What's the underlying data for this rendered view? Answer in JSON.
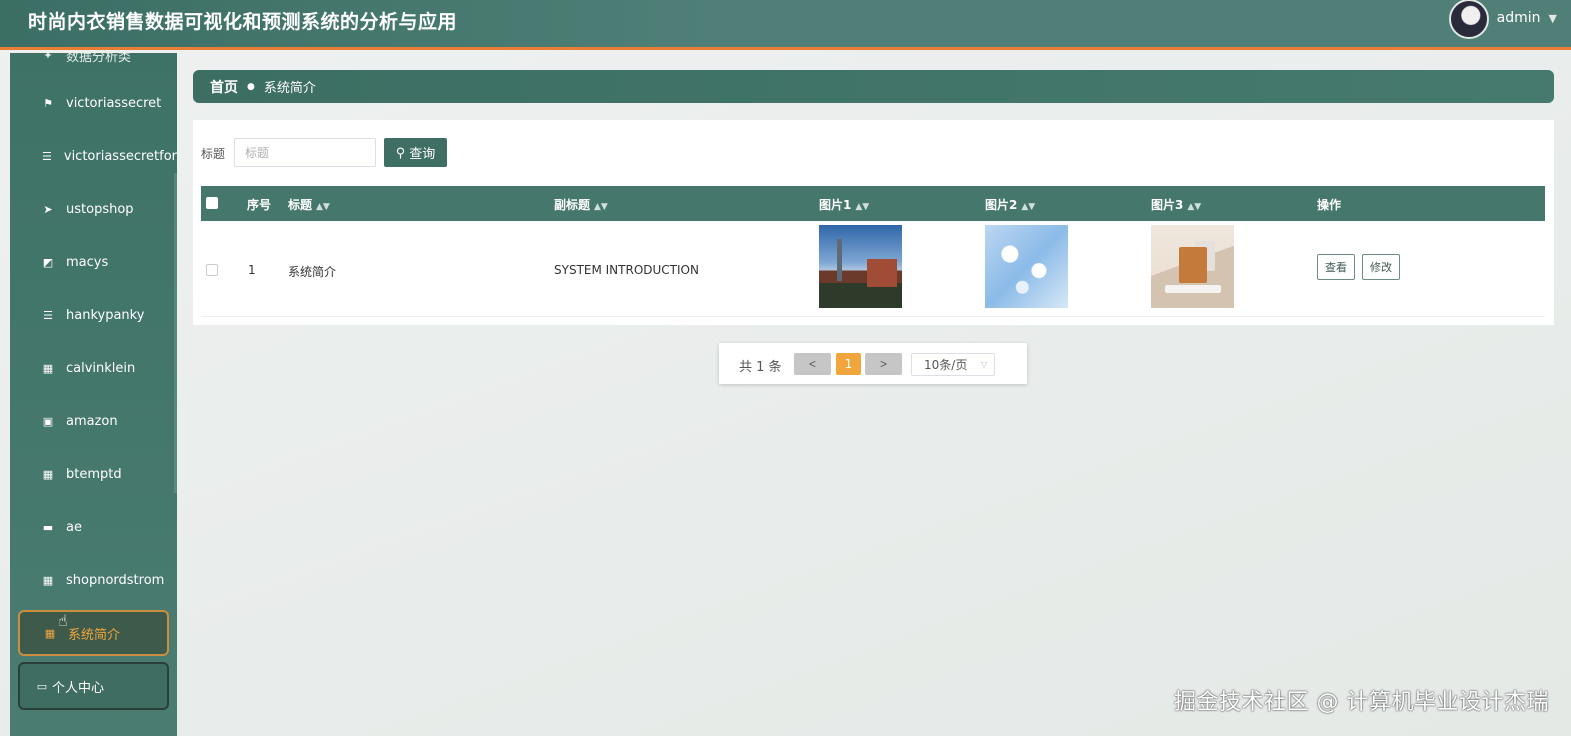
{
  "header": {
    "title": "时尚内衣销售数据可视化和预测系统的分析与应用",
    "username": "admin",
    "avatar_icon": "avatar-icon"
  },
  "sidebar": {
    "partial_item": "数据分析类",
    "items": [
      {
        "label": "victoriassecret",
        "icon": "flag-icon",
        "glyph": "⚑"
      },
      {
        "label": "victoriassecretforecast",
        "icon": "list-icon",
        "glyph": "☰"
      },
      {
        "label": "ustopshop",
        "icon": "send-icon",
        "glyph": "➤"
      },
      {
        "label": "macys",
        "icon": "chart-icon",
        "glyph": "◩"
      },
      {
        "label": "hankypanky",
        "icon": "list-icon",
        "glyph": "☰"
      },
      {
        "label": "calvinklein",
        "icon": "grid-icon",
        "glyph": "▦"
      },
      {
        "label": "amazon",
        "icon": "clipboard-icon",
        "glyph": "▣"
      },
      {
        "label": "btemptd",
        "icon": "grid-icon",
        "glyph": "▦"
      },
      {
        "label": "ae",
        "icon": "ticket-icon",
        "glyph": "▬"
      },
      {
        "label": "shopnordstrom",
        "icon": "grid-icon",
        "glyph": "▦"
      }
    ],
    "active_item": {
      "label": "系统简介",
      "icon": "grid-icon",
      "glyph": "▦"
    },
    "personal_item": {
      "label": "个人中心",
      "icon": "card-icon",
      "glyph": "▭"
    }
  },
  "breadcrumb": {
    "home": "首页",
    "current": "系统简介"
  },
  "search": {
    "label": "标题",
    "placeholder": "标题",
    "button_label": "查询"
  },
  "table": {
    "columns": [
      "序号",
      "标题",
      "副标题",
      "图片1",
      "图片2",
      "图片3",
      "操作"
    ],
    "rows": [
      {
        "index": "1",
        "title": "系统简介",
        "subtitle": "SYSTEM INTRODUCTION",
        "actions": [
          "查看",
          "修改"
        ]
      }
    ]
  },
  "pagination": {
    "total": "共 1 条",
    "prev": "<",
    "current_page": "1",
    "next": ">",
    "page_size": "10条/页"
  },
  "watermark": "掘金技术社区 @ 计算机毕业设计杰瑞",
  "colors": {
    "primary": "#3f6e64",
    "accent": "#f0a53d",
    "header_border": "#e87d33"
  }
}
